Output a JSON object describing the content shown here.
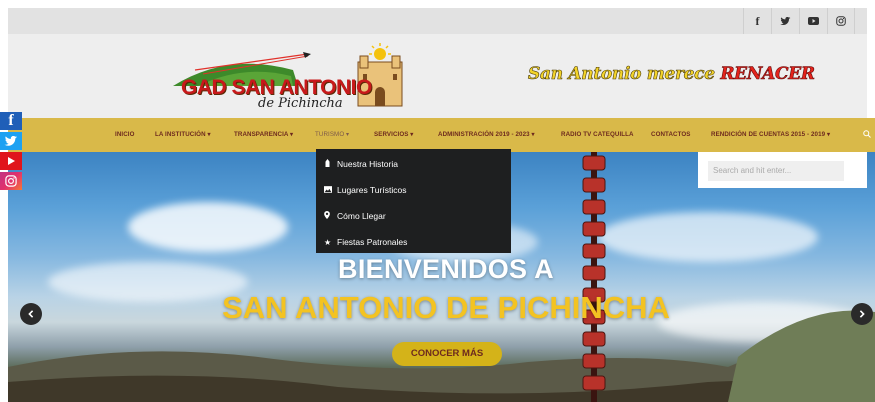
{
  "social_top": [
    "f",
    "y",
    "yt",
    "ig"
  ],
  "header": {
    "logo_line1": "GAD SAN ANTONIO",
    "logo_line2": "de Pichincha",
    "slogan_part1": "San Antonio merece ",
    "slogan_part2": "RENACER"
  },
  "nav": {
    "items": [
      {
        "label": "INICIO"
      },
      {
        "label": "LA INSTITUCIÓN ▾"
      },
      {
        "label": "TRANSPARENCIA ▾"
      },
      {
        "label": "TURISMO ▾"
      },
      {
        "label": "SERVICIOS ▾"
      },
      {
        "label": "ADMINISTRACIÓN 2019 - 2023 ▾"
      },
      {
        "label": "RADIO TV CATEQUILLA"
      },
      {
        "label": "CONTACTOS"
      },
      {
        "label": "RENDICIÓN DE CUENTAS 2015 - 2019 ▾"
      }
    ],
    "search_icon": "search-icon"
  },
  "side_social": [
    "f",
    "t",
    "yt",
    "ig"
  ],
  "dropdown": {
    "items": [
      {
        "label": "Nuestra Historia",
        "icon": "landmark-icon"
      },
      {
        "label": "Lugares Turísticos",
        "icon": "image-icon"
      },
      {
        "label": "Cómo Llegar",
        "icon": "map-pin-icon"
      },
      {
        "label": "Fiestas Patronales",
        "icon": "star-icon"
      }
    ]
  },
  "search": {
    "placeholder": "Search and hit enter..."
  },
  "hero": {
    "title_line1": "BIENVENIDOS A",
    "title_line2": "SAN ANTONIO DE PICHINCHA",
    "cta_label": "CONOCER MÁS"
  },
  "colors": {
    "nav_bg": "#d9b949",
    "nav_text": "#6d2a1e",
    "title_yellow": "#f3c322",
    "cta_bg": "#d4b319",
    "dropdown_bg": "#1e1f20"
  }
}
